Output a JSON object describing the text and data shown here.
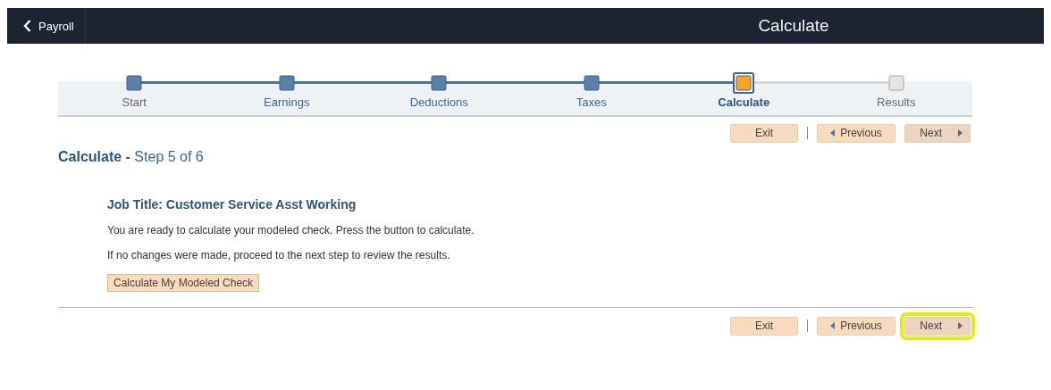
{
  "header": {
    "back_label": "Payroll",
    "title": "Calculate"
  },
  "steps": [
    {
      "label": "Start",
      "completed": true,
      "selected": false
    },
    {
      "label": "Earnings",
      "completed": true,
      "selected": false
    },
    {
      "label": "Deductions",
      "completed": true,
      "selected": false
    },
    {
      "label": "Taxes",
      "completed": true,
      "selected": false
    },
    {
      "label": "Calculate",
      "completed": false,
      "selected": true
    },
    {
      "label": "Results",
      "completed": false,
      "selected": false
    }
  ],
  "top_nav": [
    {
      "label": "Exit",
      "kind": "exit",
      "highlighted": false
    },
    {
      "label": "Previous",
      "kind": "previous",
      "highlighted": false
    },
    {
      "label": "Next",
      "kind": "next",
      "highlighted": false
    }
  ],
  "heading": {
    "title": "Calculate",
    "separator": "-",
    "subtitle": "Step 5 of 6"
  },
  "job_title": "Job Title: Customer Service Asst Working",
  "paragraphs": [
    "You are ready to calculate your modeled check. Press the button to calculate.",
    "If no changes were made, proceed to the next step to review the results."
  ],
  "action_button": "Calculate My Modeled Check",
  "bottom_nav": [
    {
      "label": "Exit",
      "kind": "exit",
      "highlighted": false
    },
    {
      "label": "Previous",
      "kind": "previous",
      "highlighted": false
    },
    {
      "label": "Next",
      "kind": "next",
      "highlighted": true
    }
  ]
}
